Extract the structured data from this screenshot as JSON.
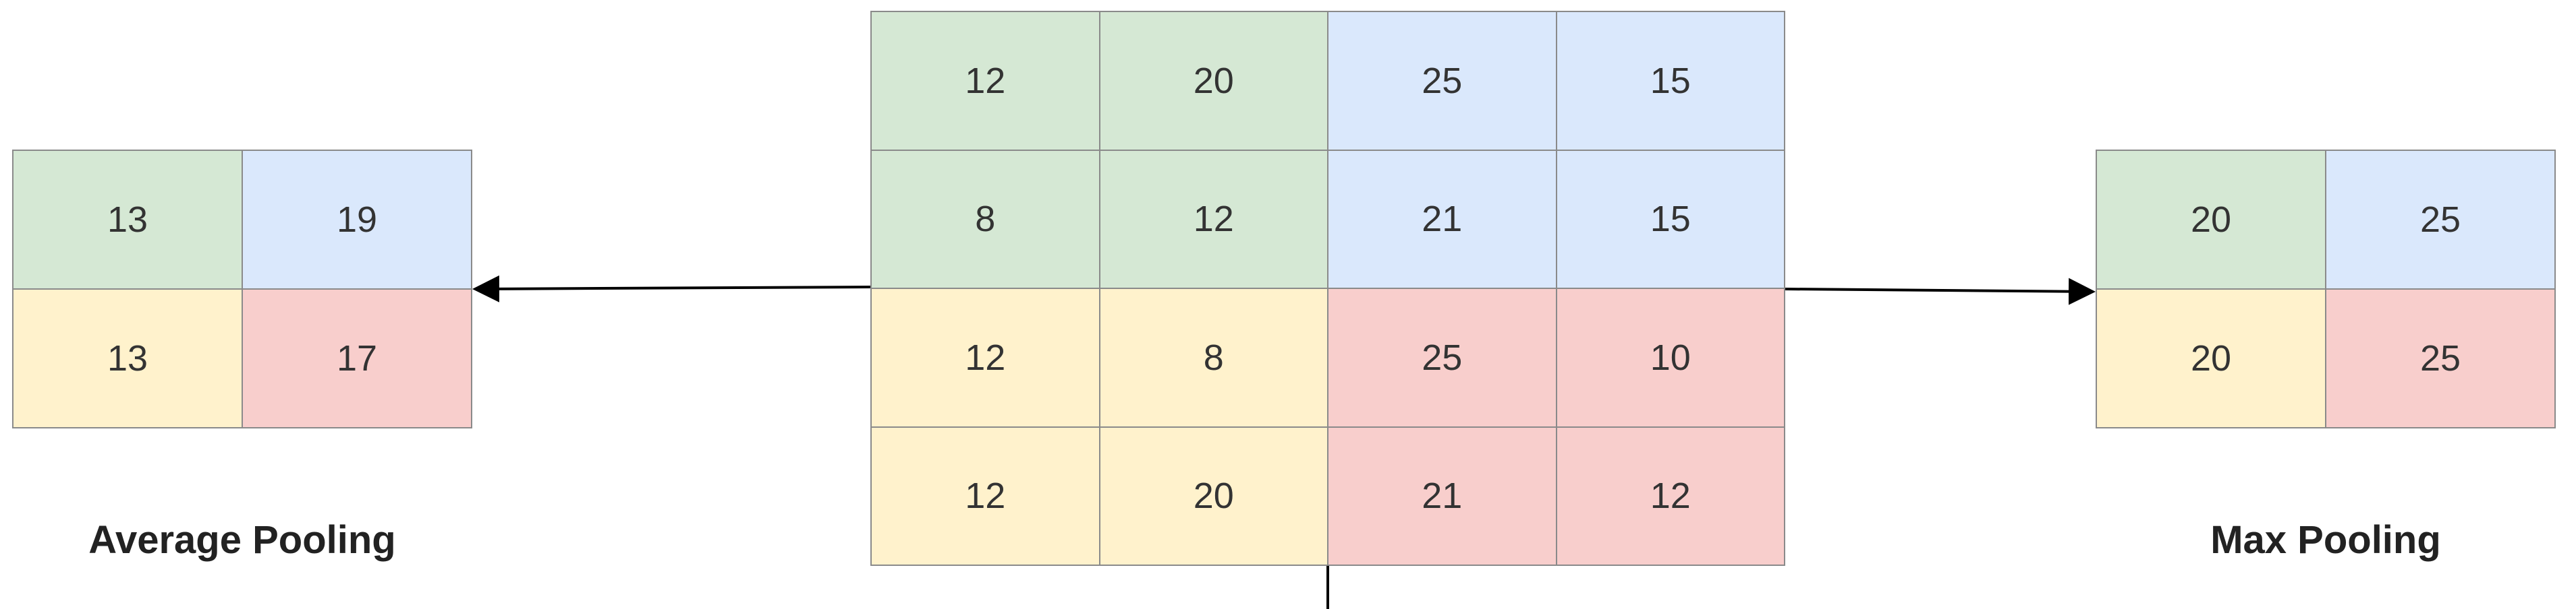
{
  "input_matrix": {
    "rows": [
      [
        {
          "value": "12",
          "color": "green"
        },
        {
          "value": "20",
          "color": "green"
        },
        {
          "value": "25",
          "color": "blue"
        },
        {
          "value": "15",
          "color": "blue"
        }
      ],
      [
        {
          "value": "8",
          "color": "green"
        },
        {
          "value": "12",
          "color": "green"
        },
        {
          "value": "21",
          "color": "blue"
        },
        {
          "value": "15",
          "color": "blue"
        }
      ],
      [
        {
          "value": "12",
          "color": "yellow"
        },
        {
          "value": "8",
          "color": "yellow"
        },
        {
          "value": "25",
          "color": "red"
        },
        {
          "value": "10",
          "color": "red"
        }
      ],
      [
        {
          "value": "12",
          "color": "yellow"
        },
        {
          "value": "20",
          "color": "yellow"
        },
        {
          "value": "21",
          "color": "red"
        },
        {
          "value": "12",
          "color": "red"
        }
      ]
    ]
  },
  "average_pooling": {
    "label": "Average Pooling",
    "rows": [
      [
        {
          "value": "13",
          "color": "green"
        },
        {
          "value": "19",
          "color": "blue"
        }
      ],
      [
        {
          "value": "13",
          "color": "yellow"
        },
        {
          "value": "17",
          "color": "red"
        }
      ]
    ]
  },
  "max_pooling": {
    "label": "Max Pooling",
    "rows": [
      [
        {
          "value": "20",
          "color": "green"
        },
        {
          "value": "25",
          "color": "blue"
        }
      ],
      [
        {
          "value": "20",
          "color": "yellow"
        },
        {
          "value": "25",
          "color": "red"
        }
      ]
    ]
  },
  "colors": {
    "green": "#d5e8d4",
    "blue": "#dae8fc",
    "yellow": "#fff2cc",
    "red": "#f8cecc",
    "border": "#8a8a8a",
    "arrow": "#000000"
  }
}
